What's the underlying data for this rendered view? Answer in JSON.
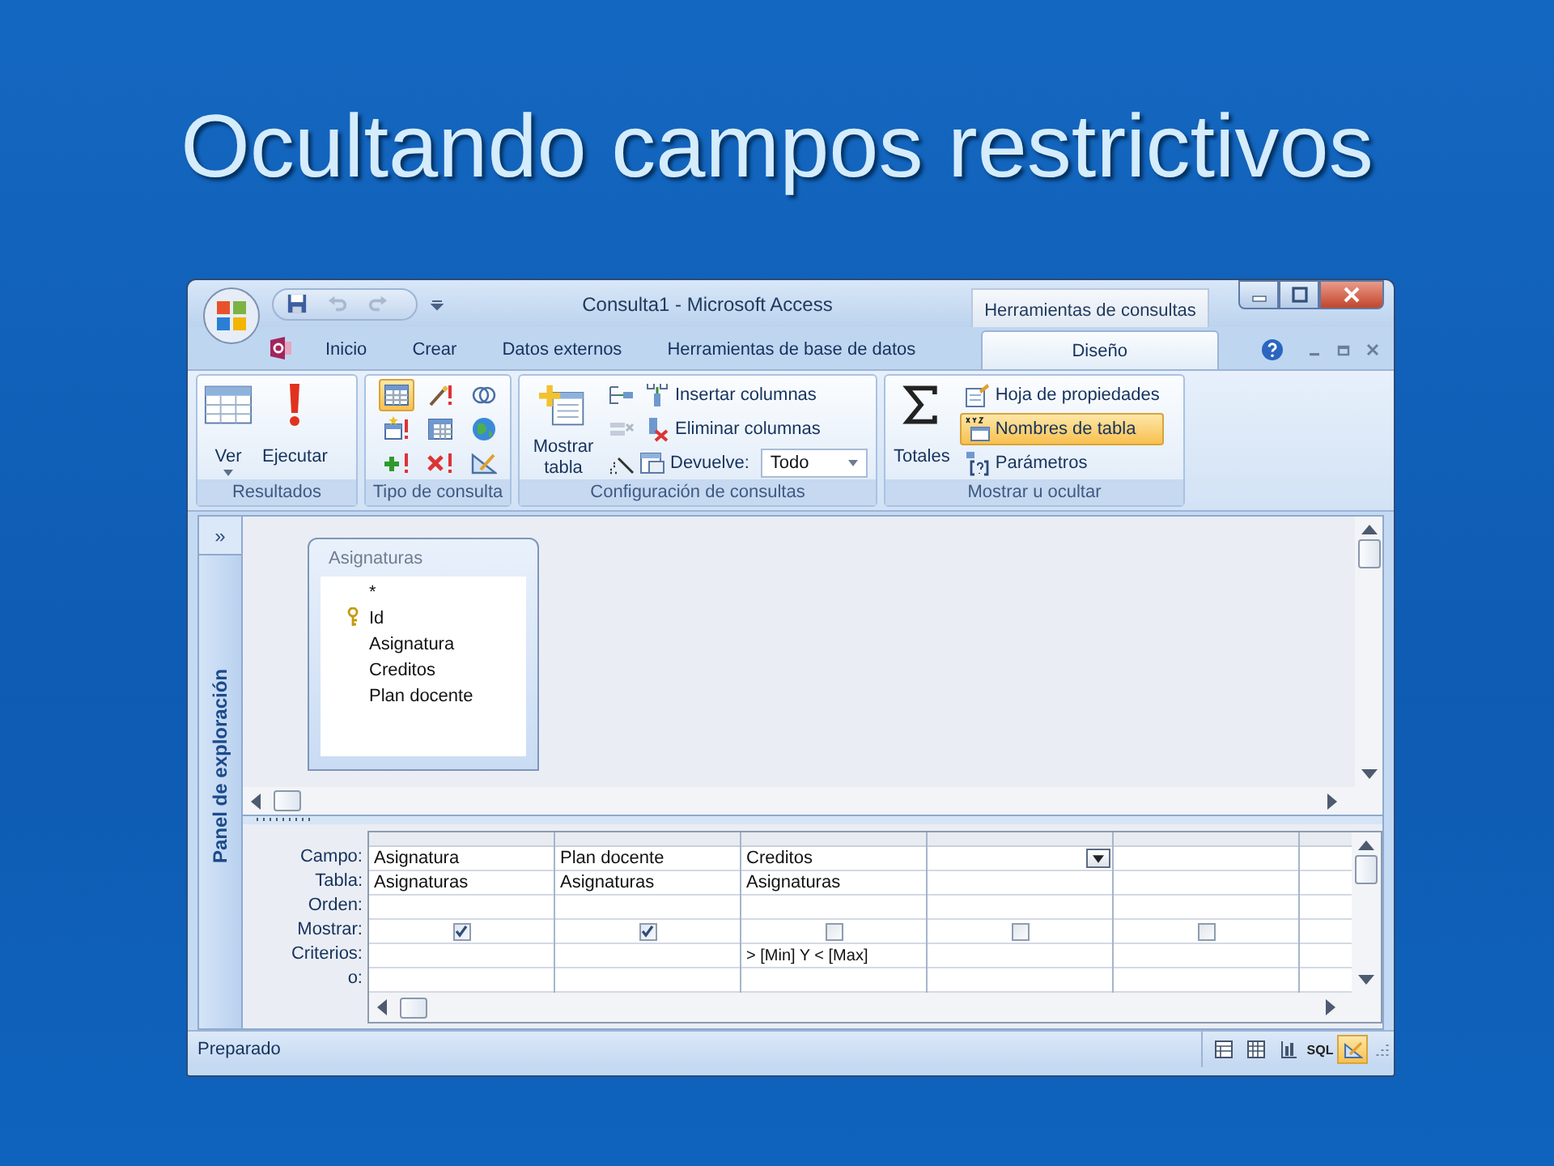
{
  "slide": {
    "title": "Ocultando campos restrictivos"
  },
  "window": {
    "title": "Consulta1 - Microsoft Access",
    "context_label": "Herramientas de consultas"
  },
  "tabs": [
    {
      "label": "Inicio",
      "selected": false,
      "contextual": false
    },
    {
      "label": "Crear",
      "selected": false,
      "contextual": false
    },
    {
      "label": "Datos externos",
      "selected": false,
      "contextual": false
    },
    {
      "label": "Herramientas de base de datos",
      "selected": false,
      "contextual": false
    },
    {
      "label": "Diseño",
      "selected": true,
      "contextual": true
    }
  ],
  "ribbon": {
    "resultados": {
      "label": "Resultados",
      "buttons": [
        "Ver",
        "Ejecutar"
      ]
    },
    "tipo_consulta": {
      "label": "Tipo de consulta",
      "buttons": [
        {
          "selected": true
        },
        {
          "selected": false
        },
        {
          "selected": false
        },
        {
          "selected": false
        },
        {
          "selected": false
        },
        {
          "selected": false
        },
        {
          "selected": false
        },
        {
          "selected": false
        },
        {
          "selected": false
        }
      ]
    },
    "configuracion": {
      "label": "Configuración de consultas",
      "show_table": "Mostrar tabla",
      "insert_columns": "Insertar columnas",
      "delete_columns": "Eliminar columnas",
      "returns_label": "Devuelve:",
      "returns_value": "Todo"
    },
    "mostrar": {
      "label": "Mostrar u ocultar",
      "totals": "Totales",
      "options": [
        {
          "label": "Hoja de propiedades",
          "selected": false
        },
        {
          "label": "Nombres de tabla",
          "selected": true
        },
        {
          "label": "Parámetros",
          "selected": false
        }
      ]
    }
  },
  "nav_pane": {
    "expand": "»",
    "label": "Panel de exploración"
  },
  "table_box": {
    "title": "Asignaturas",
    "fields": [
      {
        "name": "*",
        "primary_key": false
      },
      {
        "name": "Id",
        "primary_key": true
      },
      {
        "name": "Asignatura",
        "primary_key": false
      },
      {
        "name": "Creditos",
        "primary_key": false
      },
      {
        "name": "Plan docente",
        "primary_key": false
      }
    ]
  },
  "grid": {
    "row_labels": [
      "Campo:",
      "Tabla:",
      "Orden:",
      "Mostrar:",
      "Criterios:",
      "o:"
    ],
    "columns": [
      {
        "field": "Asignatura",
        "table": "Asignaturas",
        "show": true,
        "active": false
      },
      {
        "field": "Plan docente",
        "table": "Asignaturas",
        "show": true,
        "active": false
      },
      {
        "field": "Creditos",
        "table": "Asignaturas",
        "show": false,
        "criteria": "> [Min] Y < [Max]",
        "active": false
      },
      {
        "show": false,
        "active": true
      },
      {
        "show": false,
        "active": false
      }
    ]
  },
  "status_bar": {
    "text": "Preparado",
    "views": [
      {
        "selected": false
      },
      {
        "selected": false
      },
      {
        "selected": false
      },
      {
        "label": "SQL",
        "selected": false
      },
      {
        "selected": true
      }
    ]
  }
}
